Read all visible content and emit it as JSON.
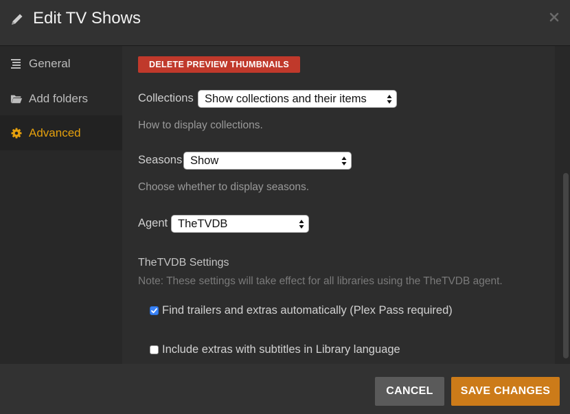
{
  "header": {
    "title": "Edit TV Shows",
    "pencil_icon": "pencil-icon",
    "close_icon": "close-icon"
  },
  "sidebar": {
    "items": [
      {
        "label": "General",
        "icon": "list-icon",
        "active": false
      },
      {
        "label": "Add folders",
        "icon": "folder-icon",
        "active": false
      },
      {
        "label": "Advanced",
        "icon": "gear-icon",
        "active": true
      }
    ]
  },
  "main": {
    "delete_button": "DELETE PREVIEW THUMBNAILS",
    "collections": {
      "label": "Collections",
      "value": "Show collections and their items",
      "help": "How to display collections."
    },
    "seasons": {
      "label": "Seasons",
      "value": "Show",
      "help": "Choose whether to display seasons."
    },
    "agent": {
      "label": "Agent",
      "value": "TheTVDB"
    },
    "settings_title": "TheTVDB Settings",
    "settings_note": "Note: These settings will take effect for all libraries using the TheTVDB agent.",
    "checkboxes": [
      {
        "label": "Find trailers and extras automatically (Plex Pass required)",
        "checked": true
      },
      {
        "label": "Include extras with subtitles in Library language",
        "checked": false
      }
    ]
  },
  "footer": {
    "cancel_label": "CANCEL",
    "save_label": "SAVE CHANGES"
  },
  "colors": {
    "accent": "#e5a00d",
    "save_button": "#cc7b19",
    "delete_button": "#c0392b",
    "checkbox_checked": "#3a82f6"
  }
}
